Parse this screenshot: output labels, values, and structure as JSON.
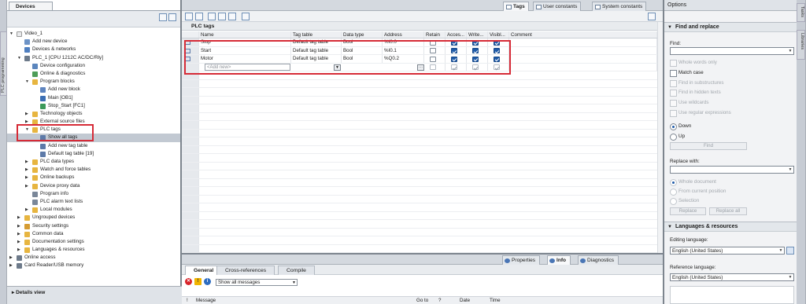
{
  "side_strip": {
    "left_label": "PLC programming",
    "right_tasks": "Tasks",
    "right_libraries": "Libraries"
  },
  "devices_panel": {
    "tab_label": "Devices",
    "tree": [
      {
        "label": "Video_1",
        "level": 0,
        "expand": "down",
        "icon": "project"
      },
      {
        "label": "Add new device",
        "level": 1,
        "expand": "",
        "icon": "add-device"
      },
      {
        "label": "Devices & networks",
        "level": 1,
        "expand": "",
        "icon": "network"
      },
      {
        "label": "PLC_1 [CPU 1212C AC/DC/Rly]",
        "level": 1,
        "expand": "down",
        "icon": "cpu"
      },
      {
        "label": "Device configuration",
        "level": 2,
        "expand": "",
        "icon": "config"
      },
      {
        "label": "Online & diagnostics",
        "level": 2,
        "expand": "",
        "icon": "diagnostics"
      },
      {
        "label": "Program blocks",
        "level": 2,
        "expand": "down",
        "icon": "folder"
      },
      {
        "label": "Add new block",
        "level": 3,
        "expand": "",
        "icon": "add-block"
      },
      {
        "label": "Main [OB1]",
        "level": 3,
        "expand": "",
        "icon": "ob-block"
      },
      {
        "label": "Stop_Start [FC1]",
        "level": 3,
        "expand": "",
        "icon": "fc-block"
      },
      {
        "label": "Technology objects",
        "level": 2,
        "expand": "right",
        "icon": "folder"
      },
      {
        "label": "External source files",
        "level": 2,
        "expand": "right",
        "icon": "folder"
      },
      {
        "label": "PLC tags",
        "level": 2,
        "expand": "down",
        "icon": "folder"
      },
      {
        "label": "Show all tags",
        "level": 3,
        "expand": "",
        "icon": "tags",
        "selected": true
      },
      {
        "label": "Add new tag table",
        "level": 3,
        "expand": "",
        "icon": "add-tag-table"
      },
      {
        "label": "Default tag table [19]",
        "level": 3,
        "expand": "",
        "icon": "tag-table"
      },
      {
        "label": "PLC data types",
        "level": 2,
        "expand": "right",
        "icon": "folder"
      },
      {
        "label": "Watch and force tables",
        "level": 2,
        "expand": "right",
        "icon": "folder"
      },
      {
        "label": "Online backups",
        "level": 2,
        "expand": "right",
        "icon": "folder"
      },
      {
        "label": "Device proxy data",
        "level": 2,
        "expand": "right",
        "icon": "folder"
      },
      {
        "label": "Program info",
        "level": 2,
        "expand": "",
        "icon": "program-info"
      },
      {
        "label": "PLC alarm text lists",
        "level": 2,
        "expand": "",
        "icon": "text-list"
      },
      {
        "label": "Local modules",
        "level": 2,
        "expand": "right",
        "icon": "folder"
      },
      {
        "label": "Ungrouped devices",
        "level": 1,
        "expand": "right",
        "icon": "folder"
      },
      {
        "label": "Security settings",
        "level": 1,
        "expand": "right",
        "icon": "security"
      },
      {
        "label": "Common data",
        "level": 1,
        "expand": "right",
        "icon": "folder"
      },
      {
        "label": "Documentation settings",
        "level": 1,
        "expand": "right",
        "icon": "folder"
      },
      {
        "label": "Languages & resources",
        "level": 1,
        "expand": "right",
        "icon": "folder"
      },
      {
        "label": "Online access",
        "level": 0,
        "expand": "right",
        "icon": "online"
      },
      {
        "label": "Card Reader/USB memory",
        "level": 0,
        "expand": "right",
        "icon": "card-reader"
      }
    ],
    "details_view": "Details view"
  },
  "editor": {
    "tabs": [
      {
        "label": "Tags",
        "active": true
      },
      {
        "label": "User constants",
        "active": false
      },
      {
        "label": "System constants",
        "active": false
      }
    ],
    "title": "PLC tags",
    "columns": [
      "",
      "Name",
      "Tag table",
      "Data type",
      "Address",
      "Retain",
      "Acces...",
      "Write...",
      "Visibl...",
      "Comment"
    ],
    "rows": [
      {
        "num": "1",
        "name": "Stop",
        "table": "Default tag table",
        "type": "Bool",
        "address": "%I0.0",
        "retain": false,
        "access": true,
        "write": true,
        "visible": true,
        "comment": ""
      },
      {
        "num": "2",
        "name": "Start",
        "table": "Default tag table",
        "type": "Bool",
        "address": "%I0.1",
        "retain": false,
        "access": true,
        "write": true,
        "visible": true,
        "comment": ""
      },
      {
        "num": "3",
        "name": "Motor",
        "table": "Default tag table",
        "type": "Bool",
        "address": "%Q0.2",
        "retain": false,
        "access": true,
        "write": true,
        "visible": true,
        "comment": ""
      }
    ],
    "add_new_placeholder": "<Add new>"
  },
  "inspector": {
    "top_tabs": [
      {
        "label": "Properties"
      },
      {
        "label": "Info",
        "active": true
      },
      {
        "label": "Diagnostics"
      }
    ],
    "sub_tabs": [
      {
        "label": "General",
        "active": true
      },
      {
        "label": "Cross-references"
      },
      {
        "label": "Compile"
      }
    ],
    "filter_value": "Show all messages",
    "columns": [
      "!",
      "Message",
      "Go to",
      "?",
      "Date",
      "Time"
    ]
  },
  "options": {
    "title": "Options",
    "find_replace": {
      "header": "Find and replace",
      "find_label": "Find:",
      "checks": [
        {
          "label": "Whole words only",
          "enabled": false
        },
        {
          "label": "Match case",
          "enabled": true
        },
        {
          "label": "Find in substructures",
          "enabled": false
        },
        {
          "label": "Find in hidden texts",
          "enabled": false
        },
        {
          "label": "Use wildcards",
          "enabled": false
        },
        {
          "label": "Use regular expressions",
          "enabled": false
        }
      ],
      "down": "Down",
      "up": "Up",
      "find_button": "Find",
      "replace_label": "Replace with:",
      "scope": [
        {
          "label": "Whole document"
        },
        {
          "label": "From current position"
        },
        {
          "label": "Selection"
        }
      ],
      "replace_button": "Replace",
      "replace_all_button": "Replace all"
    },
    "languages": {
      "header": "Languages & resources",
      "editing_label": "Editing language:",
      "editing_value": "English (United States)",
      "reference_label": "Reference language:",
      "reference_value": "English (United States)"
    }
  },
  "colors": {
    "highlight_red": "#d62b37",
    "checkbox_blue": "#1e5aa8",
    "selection_gray": "#c2c9d2"
  }
}
